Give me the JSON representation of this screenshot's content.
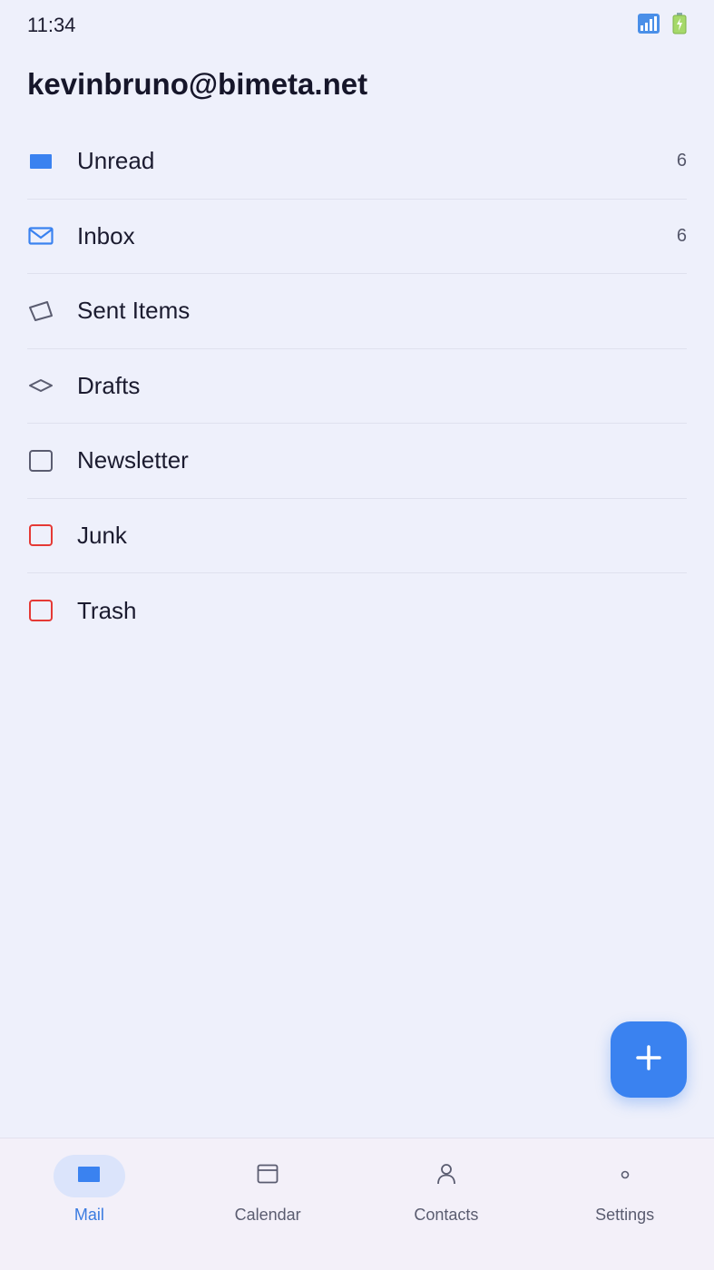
{
  "status_bar": {
    "time": "11:34",
    "icons": [
      "signal-icon",
      "battery-icon"
    ]
  },
  "account": {
    "email": "kevinbruno@bimeta.net"
  },
  "folders": [
    {
      "label": "Unread",
      "count": "6",
      "icon": "unread-icon",
      "color": "#3a82f0"
    },
    {
      "label": "Inbox",
      "count": "6",
      "icon": "inbox-icon",
      "color": "#3a82f0"
    },
    {
      "label": "Sent Items",
      "count": "",
      "icon": "sent-icon",
      "color": "#5a5c70"
    },
    {
      "label": "Drafts",
      "count": "",
      "icon": "drafts-icon",
      "color": "#5a5c70"
    },
    {
      "label": "Newsletter",
      "count": "",
      "icon": "newsletter-icon",
      "color": "#5a5c70"
    },
    {
      "label": "Junk",
      "count": "",
      "icon": "junk-icon",
      "color": "#e53935"
    },
    {
      "label": "Trash",
      "count": "",
      "icon": "trash-icon",
      "color": "#e53935"
    }
  ],
  "fab": {
    "icon": "plus-icon"
  },
  "bottom_nav": [
    {
      "label": "Mail",
      "icon": "mail-icon",
      "active": true
    },
    {
      "label": "Calendar",
      "icon": "calendar-icon",
      "active": false
    },
    {
      "label": "Contacts",
      "icon": "contacts-icon",
      "active": false
    },
    {
      "label": "Settings",
      "icon": "settings-icon",
      "active": false
    }
  ],
  "colors": {
    "accent": "#3a82f0",
    "background": "#eef0fb",
    "danger": "#e53935"
  }
}
